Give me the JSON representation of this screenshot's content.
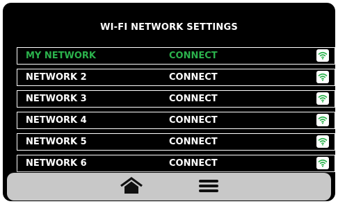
{
  "screen": {
    "title": "WI-FI NETWORK SETTINGS"
  },
  "networks": [
    {
      "name": "MY NETWORK",
      "action": "CONNECT",
      "selected": true,
      "icon": "wifi-icon"
    },
    {
      "name": "NETWORK 2",
      "action": "CONNECT",
      "selected": false,
      "icon": "wifi-icon"
    },
    {
      "name": "NETWORK 3",
      "action": "CONNECT",
      "selected": false,
      "icon": "wifi-icon"
    },
    {
      "name": "NETWORK 4",
      "action": "CONNECT",
      "selected": false,
      "icon": "wifi-icon"
    },
    {
      "name": "NETWORK 5",
      "action": "CONNECT",
      "selected": false,
      "icon": "wifi-icon"
    },
    {
      "name": "NETWORK 6",
      "action": "CONNECT",
      "selected": false,
      "icon": "wifi-icon"
    }
  ],
  "toolbar": {
    "home_icon": "home-icon",
    "menu_icon": "hamburger-menu-icon"
  },
  "colors": {
    "background": "#000000",
    "accent_green": "#2bb24c",
    "toolbar_bg": "#c8c8c8"
  }
}
